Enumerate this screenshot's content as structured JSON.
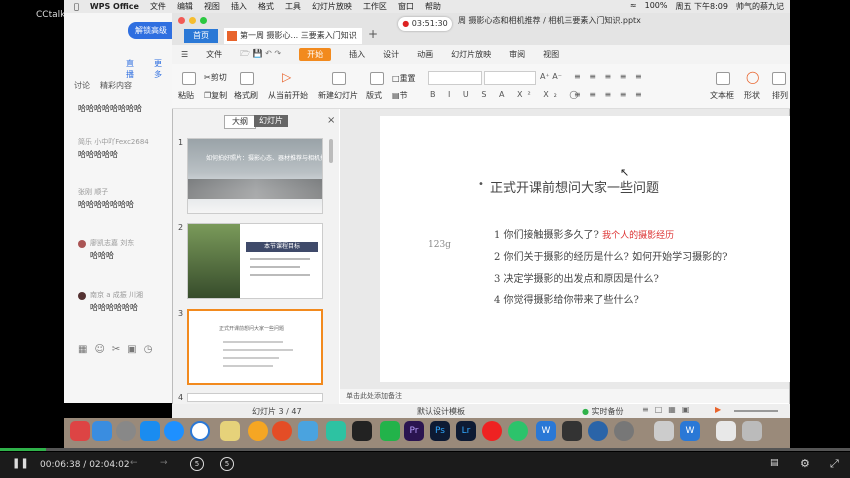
{
  "brand": "CCtalk",
  "menubar": {
    "app": "WPS Office",
    "items": [
      "文件",
      "编辑",
      "视图",
      "插入",
      "格式",
      "工具",
      "幻灯片放映",
      "工作区",
      "窗口",
      "帮助"
    ],
    "battery": "100%",
    "clock": "周五 下午8:09",
    "user": "帅气的蔡九记"
  },
  "chat": {
    "unlock_button": "解锁高级",
    "tabs": [
      "讨论",
      "精彩内容",
      "直播",
      "更多"
    ],
    "messages": [
      {
        "user": "",
        "text": "哈哈哈哈哈哈哈哈"
      },
      {
        "user": "简乐 小中吖Fexc2684",
        "text": "哈哈哈哈哈"
      },
      {
        "user": "张刚 顺子",
        "text": "哈哈哈哈哈哈哈"
      },
      {
        "user": "廖凯志嘉 刘东",
        "text": "哈哈哈"
      },
      {
        "user": "南京 a 成振 川湘",
        "text": "哈哈哈哈哈哈"
      }
    ]
  },
  "wps": {
    "home_tab": "首页",
    "doc_tab": "第一周 摄影心... 三要素入门知识",
    "recording_time": "03:51:30",
    "doc_title": "周 摄影心态和相机推荐 / 相机三要素入门知识.pptx",
    "menu": [
      "文件",
      "开始",
      "插入",
      "设计",
      "动画",
      "幻灯片放映",
      "审阅",
      "视图"
    ],
    "active_menu": "开始",
    "ribbon": {
      "paste": "粘贴",
      "cut": "剪切",
      "copy": "复制",
      "format_painter": "格式刷",
      "play_from_current": "从当前开始",
      "new_slide": "新建幻灯片",
      "layout": "版式",
      "section": "节",
      "reset": "重置",
      "textbox": "文本框",
      "shape": "形状",
      "arrange": "排列"
    },
    "panel_tabs": {
      "outline": "大纲",
      "slides": "幻灯片"
    },
    "thumbnails": [
      {
        "num": "1",
        "text": "如何拍好照片：摄影心态、器材推荐与相机推荐"
      },
      {
        "num": "2",
        "text": "本节课程目标"
      },
      {
        "num": "3",
        "text": "正式开课前想问大家一些问题"
      },
      {
        "num": "4",
        "text": ""
      }
    ],
    "slide": {
      "title": "正式开课前想问大家一些问题",
      "side_text": "123g",
      "questions": [
        {
          "text": "1 你们接触摄影多久了?",
          "note": "我个人的摄影经历"
        },
        {
          "text": "2 你们关于摄影的经历是什么? 如何开始学习摄影的?",
          "note": ""
        },
        {
          "text": "3 决定学摄影的出发点和原因是什么?",
          "note": ""
        },
        {
          "text": "4 你觉得摄影给你带来了些什么?",
          "note": ""
        }
      ]
    },
    "notes_placeholder": "单击此处添加备注",
    "status": {
      "slide_counter": "幻灯片 3 / 47",
      "template": "默认设计模板",
      "backup": "实时备份"
    }
  },
  "player": {
    "current": "00:06:38",
    "total": "02:04:02",
    "progress": 0.054,
    "rewind_label": "5",
    "forward_label": "5",
    "accent": "#2fb24a"
  }
}
